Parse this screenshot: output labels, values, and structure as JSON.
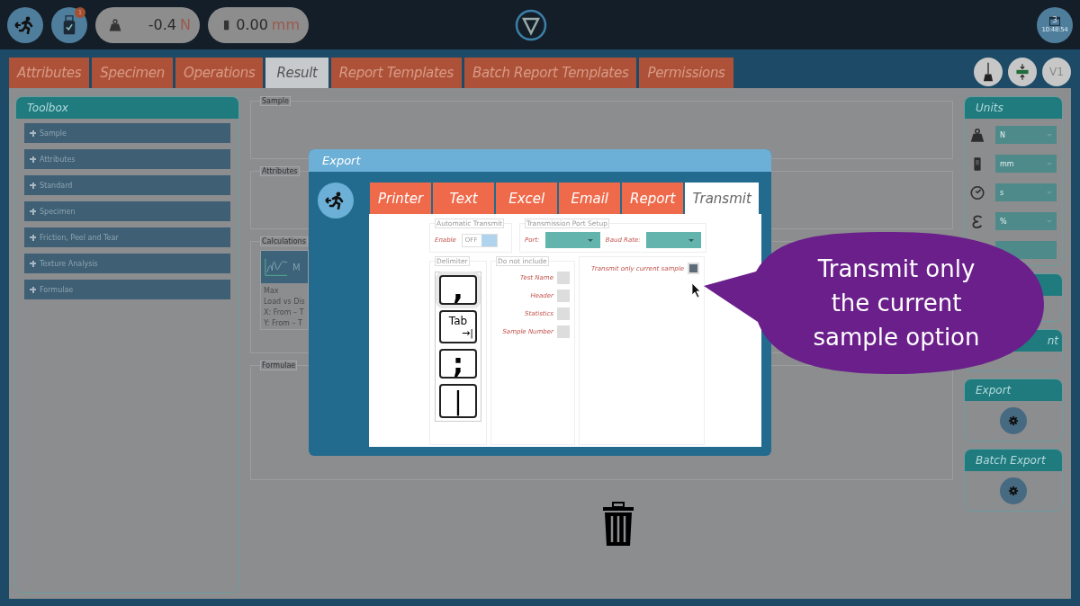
{
  "top_bar": {
    "badge": "1",
    "readouts": [
      {
        "kind": "force",
        "value": "-0.4",
        "unit": "N"
      },
      {
        "kind": "length",
        "value": "0.00",
        "unit": "mm"
      }
    ],
    "clock": {
      "day": "3",
      "time": "10:48:54"
    }
  },
  "tabs": [
    {
      "label": "Attributes",
      "selected": false
    },
    {
      "label": "Specimen",
      "selected": false
    },
    {
      "label": "Operations",
      "selected": false
    },
    {
      "label": "Result",
      "selected": true
    },
    {
      "label": "Report Templates",
      "selected": false
    },
    {
      "label": "Batch Report Templates",
      "selected": false
    },
    {
      "label": "Permissions",
      "selected": false
    }
  ],
  "tool_buttons": [
    {
      "kind": "broom"
    },
    {
      "kind": "resize"
    },
    {
      "kind": "text",
      "label": "V1"
    }
  ],
  "toolbox": {
    "title": "Toolbox",
    "items": [
      "Sample",
      "Attributes",
      "Standard",
      "Specimen",
      "Friction, Peel and Tear",
      "Texture Analysis",
      "Formulae"
    ]
  },
  "result_sections": [
    {
      "legend": "Sample"
    },
    {
      "legend": "Attributes"
    },
    {
      "legend": "Calculations",
      "card": {
        "title": "M",
        "lines": [
          "Max",
          "Load vs Dis",
          "X: From – T",
          "Y: From – T"
        ]
      }
    },
    {
      "legend": "Formulae"
    }
  ],
  "units": {
    "title": "Units",
    "rows": [
      {
        "kind": "force",
        "value": "N"
      },
      {
        "kind": "length",
        "value": "mm"
      },
      {
        "kind": "time",
        "value": "s"
      },
      {
        "kind": "strain",
        "value": "%"
      },
      {
        "kind": "blank"
      }
    ]
  },
  "side_panels": [
    {
      "kind": "empty"
    },
    {
      "kind": "empty",
      "title": "nt"
    },
    {
      "kind": "gear",
      "title": "Export"
    },
    {
      "kind": "gear",
      "title": "Batch Export"
    }
  ],
  "dialog": {
    "title": "Export",
    "tabs": [
      {
        "label": "Printer",
        "selected": false
      },
      {
        "label": "Text",
        "selected": false
      },
      {
        "label": "Excel",
        "selected": false
      },
      {
        "label": "Email",
        "selected": false
      },
      {
        "label": "Report",
        "selected": false
      },
      {
        "label": "Transmit",
        "selected": true
      }
    ],
    "automatic_transmit": {
      "legend": "Automatic Transmit",
      "label": "Enable",
      "toggle": {
        "text": "OFF",
        "on": false
      }
    },
    "port_setup": {
      "legend": "Transmission Port Setup",
      "fields": [
        {
          "label": "Port:"
        },
        {
          "label": "Baud Rate:"
        }
      ]
    },
    "delimiter": {
      "legend": "Delimiter",
      "options": [
        {
          "kind": "comma",
          "label": ",",
          "selected": true
        },
        {
          "kind": "tab",
          "label": "Tab",
          "arrow": "→|",
          "selected": false
        },
        {
          "kind": "semicolon",
          "label": ";",
          "selected": false
        },
        {
          "kind": "pipe",
          "label": "|",
          "selected": false
        }
      ]
    },
    "do_not_include": {
      "legend": "Do not include",
      "items": [
        {
          "label": "Test Name",
          "checked": false
        },
        {
          "label": "Header",
          "checked": false
        },
        {
          "label": "Statistics",
          "checked": false
        },
        {
          "label": "Sample Number",
          "checked": false
        }
      ]
    },
    "transmit_only": {
      "label": "Transmit only current sample",
      "checked": true
    }
  },
  "callout": {
    "text": "Transmit only the current sample option"
  }
}
